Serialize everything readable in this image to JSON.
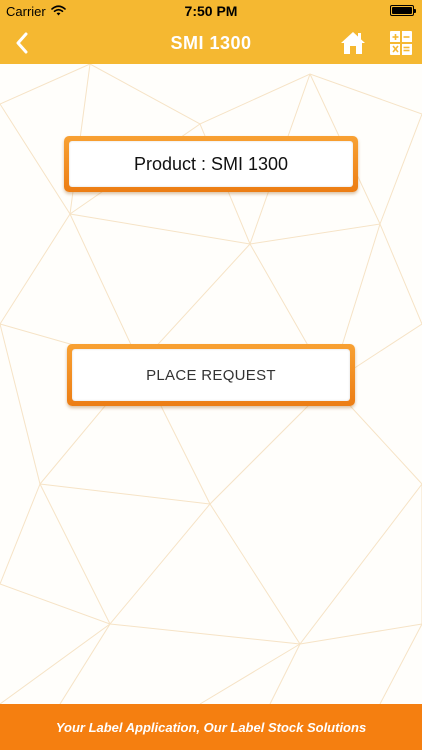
{
  "status_bar": {
    "carrier": "Carrier",
    "time": "7:50 PM",
    "wifi_icon": "wifi-icon",
    "battery_icon": "battery-icon"
  },
  "header": {
    "back_icon": "chevron-left-icon",
    "title": "SMI 1300",
    "home_icon": "home-icon",
    "calculator_icon": "calculator-icon",
    "bar_color": "#f5b831"
  },
  "main": {
    "product_label": "Product : SMI 1300",
    "place_request_label": "PLACE REQUEST",
    "button_frame_color": "#f08a1e"
  },
  "footer": {
    "tagline": "Your Label Application, Our Label Stock Solutions",
    "background_color": "#f57f10"
  }
}
